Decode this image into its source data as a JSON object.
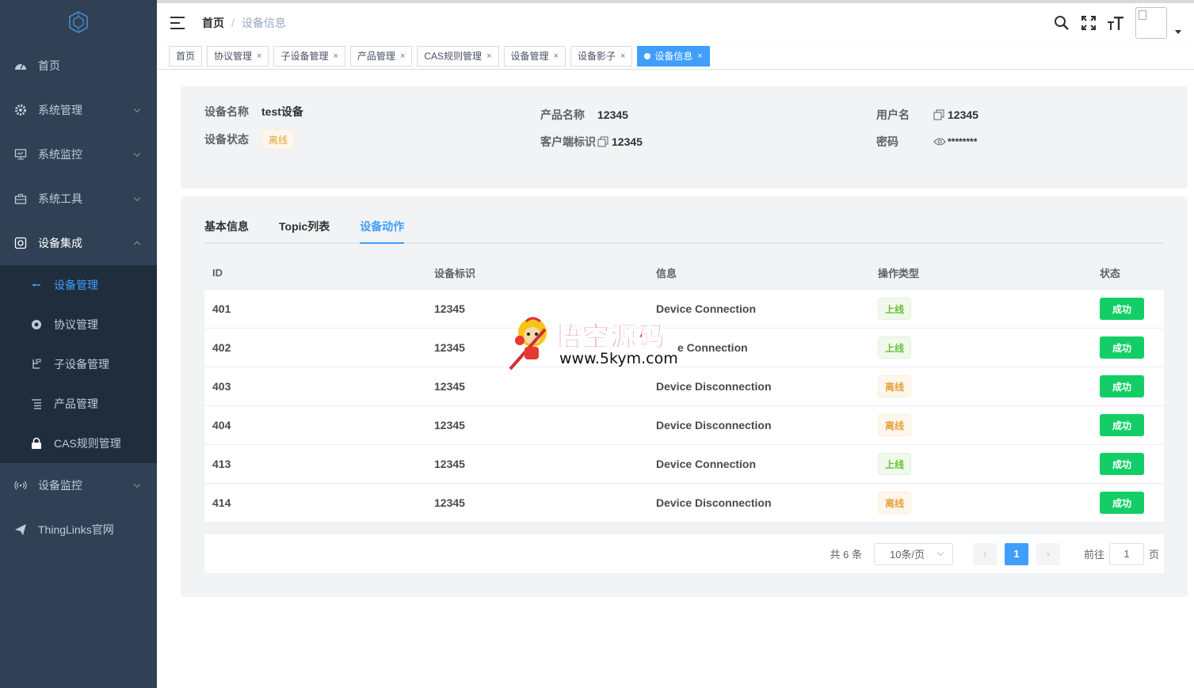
{
  "sidebar": {
    "items": [
      {
        "label": "首页",
        "icon": "dashboard-icon"
      },
      {
        "label": "系统管理",
        "icon": "gear-icon"
      },
      {
        "label": "系统监控",
        "icon": "monitor-icon"
      },
      {
        "label": "系统工具",
        "icon": "toolbox-icon"
      },
      {
        "label": "设备集成",
        "icon": "device-icon"
      }
    ],
    "sub_items": [
      {
        "label": "设备管理",
        "icon": "minus-icon"
      },
      {
        "label": "协议管理",
        "icon": "protocol-icon"
      },
      {
        "label": "子设备管理",
        "icon": "subdevice-icon"
      },
      {
        "label": "产品管理",
        "icon": "list-icon"
      },
      {
        "label": "CAS规则管理",
        "icon": "lock-icon"
      }
    ],
    "bottom_items": [
      {
        "label": "设备监控",
        "icon": "signal-icon"
      },
      {
        "label": "ThingLinks官网",
        "icon": "send-icon"
      }
    ]
  },
  "breadcrumb": {
    "home": "首页",
    "separator": "/",
    "current": "设备信息"
  },
  "tags": [
    "首页",
    "协议管理",
    "子设备管理",
    "产品管理",
    "CAS规则管理",
    "设备管理",
    "设备影子",
    "设备信息"
  ],
  "device": {
    "name_label": "设备名称",
    "name": "test设备",
    "status_label": "设备状态",
    "status": "离线",
    "product_label": "产品名称",
    "product": "12345",
    "client_label": "客户端标识",
    "client": "12345",
    "user_label": "用户名",
    "user": "12345",
    "password_label": "密码",
    "password": "********"
  },
  "tabs": [
    "基本信息",
    "Topic列表",
    "设备动作"
  ],
  "active_tab": "设备动作",
  "table": {
    "headers": [
      "ID",
      "设备标识",
      "信息",
      "操作类型",
      "状态"
    ],
    "rows": [
      {
        "id": "401",
        "device": "12345",
        "info": "Device Connection",
        "type": "上线",
        "status": "成功"
      },
      {
        "id": "402",
        "device": "12345",
        "info": "e Connection",
        "type": "上线",
        "status": "成功"
      },
      {
        "id": "403",
        "device": "12345",
        "info": "Device Disconnection",
        "type": "离线",
        "status": "成功"
      },
      {
        "id": "404",
        "device": "12345",
        "info": "Device Disconnection",
        "type": "离线",
        "status": "成功"
      },
      {
        "id": "413",
        "device": "12345",
        "info": "Device Connection",
        "type": "上线",
        "status": "成功"
      },
      {
        "id": "414",
        "device": "12345",
        "info": "Device Disconnection",
        "type": "离线",
        "status": "成功"
      }
    ]
  },
  "pagination": {
    "total": "共 6 条",
    "page_size": "10条/页",
    "current": "1",
    "goto_label": "前往",
    "goto_value": "1",
    "page_unit": "页"
  },
  "watermark": {
    "title": "悟空源码",
    "url": "www.5kym.com"
  },
  "colors": {
    "sidebar": "#304156",
    "submenu": "#1f2d3d",
    "accent": "#409eff",
    "success": "#13ce66",
    "warning": "#e6a23c"
  }
}
